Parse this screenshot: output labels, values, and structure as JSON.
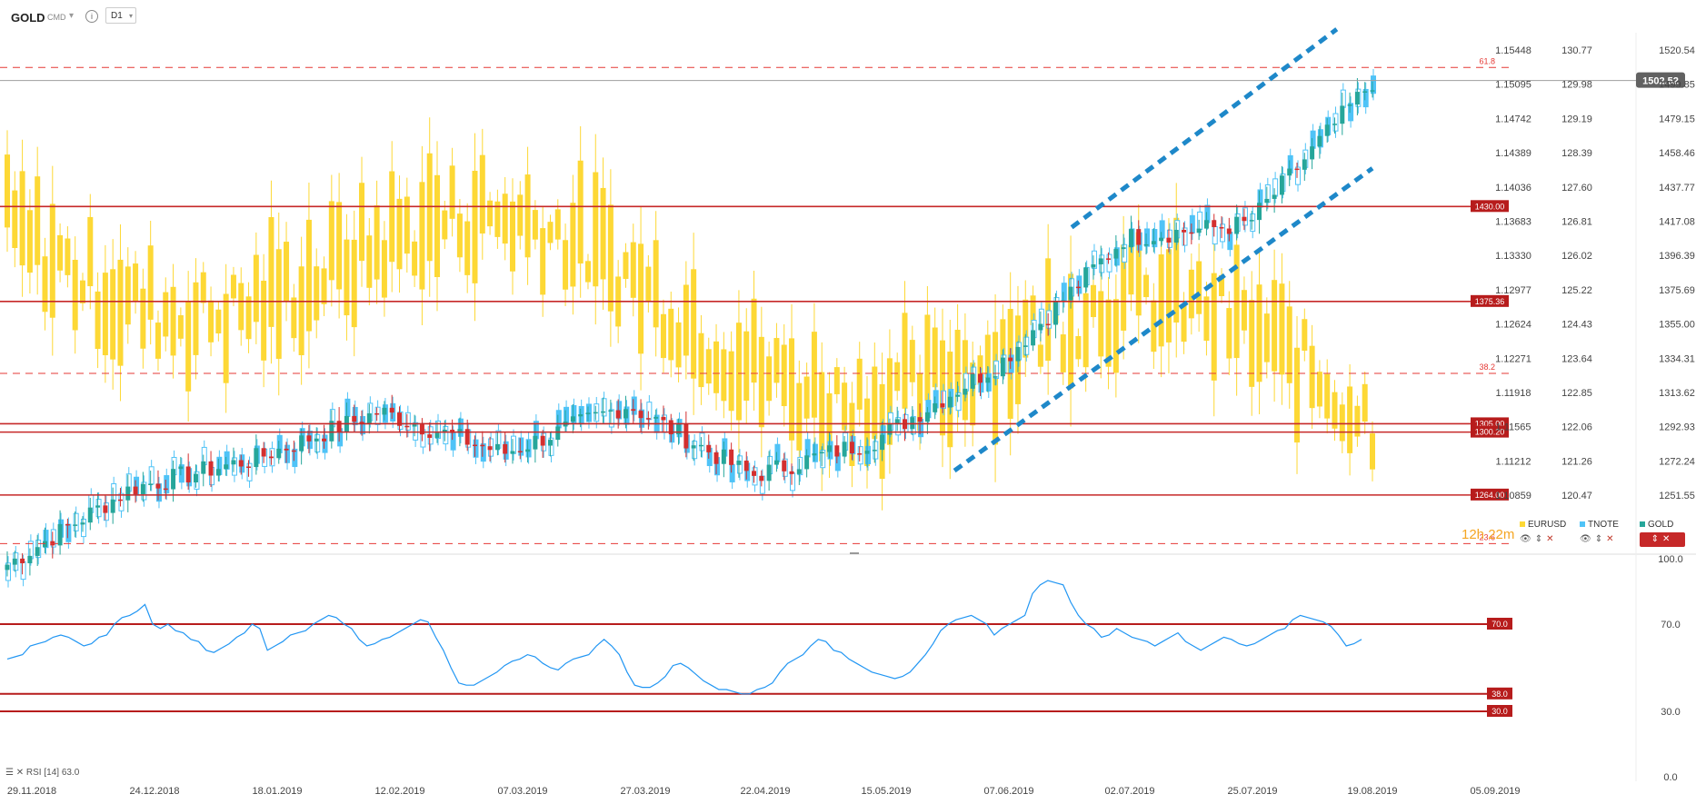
{
  "header": {
    "symbol": "GOLD",
    "instrument_type": "CMD",
    "interval": "D1",
    "info_icon": "info-icon",
    "chevron_icon": "chevron-down-icon"
  },
  "countdown": "12h 22m",
  "legend": {
    "items": [
      {
        "name": "EURUSD",
        "color": "#fdd835"
      },
      {
        "name": "TNOTE",
        "color": "#4fc3f7"
      },
      {
        "name": "GOLD",
        "color": "#26a69a"
      }
    ],
    "eye_icon": "eye-icon",
    "updown_icon": "up-down-arrows-icon",
    "close_icon": "close-icon",
    "eye_glyph": "👁",
    "updown_glyph": "⇕",
    "close_glyph": "✕"
  },
  "rsi_label": "RSI [14] 63.0",
  "chart_data": [
    {
      "type": "candlestick",
      "title": "GOLD D1",
      "overlays": [
        "EURUSD",
        "TNOTE"
      ],
      "x_tick_labels": [
        "29.11.2018",
        "24.12.2018",
        "18.01.2019",
        "12.02.2019",
        "07.03.2019",
        "27.03.2019",
        "22.04.2019",
        "15.05.2019",
        "07.06.2019",
        "02.07.2019",
        "25.07.2019",
        "19.08.2019",
        "05.09.2019"
      ],
      "ylim": [
        1231.0,
        1530.0
      ],
      "y_axis_gold": [
        "1520.54",
        "1499.85",
        "1479.15",
        "1458.46",
        "1437.77",
        "1417.08",
        "1396.39",
        "1375.69",
        "1355.00",
        "1334.31",
        "1313.62",
        "1292.93",
        "1272.24",
        "1251.55"
      ],
      "y_axis_tnote": [
        "130.77",
        "129.98",
        "129.19",
        "128.39",
        "127.60",
        "126.81",
        "126.02",
        "125.22",
        "124.43",
        "123.64",
        "122.85",
        "122.06",
        "121.26",
        "120.47"
      ],
      "y_axis_eurusd": [
        "1.15448",
        "1.15095",
        "1.14742",
        "1.14389",
        "1.14036",
        "1.13683",
        "1.13330",
        "1.12977",
        "1.12624",
        "1.12271",
        "1.11918",
        "1.11565",
        "1.11212",
        "1.10859"
      ],
      "last_price": "1502.52",
      "support_resistance": [
        {
          "label": "1430.00",
          "value": 1430.0
        },
        {
          "label": "1375.36",
          "value": 1375.36
        },
        {
          "label": "1305.00",
          "value": 1305.0
        },
        {
          "label": "1300.20",
          "value": 1300.2
        },
        {
          "label": "1264.00",
          "value": 1264.0
        }
      ],
      "fibonacci": [
        {
          "label": "61.8",
          "value": 1510.0
        },
        {
          "label": "38.2",
          "value": 1334.0
        },
        {
          "label": "23.6",
          "value": 1236.0
        }
      ],
      "band_label": "",
      "trend_channel": {
        "upper": [
          [
            "21.06.2019",
            1418
          ],
          [
            "12.08.2019",
            1532
          ]
        ],
        "lower": [
          [
            "29.05.2019",
            1278
          ],
          [
            "19.08.2019",
            1452
          ]
        ]
      },
      "gold_ohlc_approx": [
        {
          "date": "29.11.2018",
          "close": 1224
        },
        {
          "date": "24.12.2018",
          "close": 1268
        },
        {
          "date": "18.01.2019",
          "close": 1285
        },
        {
          "date": "12.02.2019",
          "close": 1312
        },
        {
          "date": "07.03.2019",
          "close": 1288
        },
        {
          "date": "27.03.2019",
          "close": 1316
        },
        {
          "date": "22.04.2019",
          "close": 1275
        },
        {
          "date": "15.05.2019",
          "close": 1296
        },
        {
          "date": "07.06.2019",
          "close": 1340
        },
        {
          "date": "02.07.2019",
          "close": 1412
        },
        {
          "date": "25.07.2019",
          "close": 1420
        },
        {
          "date": "19.08.2019",
          "close": 1502
        }
      ],
      "legend": [
        "EURUSD",
        "TNOTE",
        "GOLD"
      ]
    },
    {
      "type": "line",
      "title": "RSI [14]",
      "ylim": [
        0,
        100
      ],
      "y_tick_labels": [
        "100.0",
        "70.0",
        "30.0",
        "0.0"
      ],
      "levels": [
        {
          "label": "70.0",
          "value": 70
        },
        {
          "label": "38.0",
          "value": 38
        },
        {
          "label": "30.0",
          "value": 30
        }
      ],
      "last_value": 63.0,
      "series": [
        {
          "values": [
            54,
            55,
            56,
            60,
            61,
            62,
            64,
            65,
            64,
            62,
            60,
            61,
            64,
            65,
            70,
            73,
            74,
            76,
            79,
            70,
            68,
            70,
            67,
            66,
            63,
            62,
            58,
            57,
            59,
            61,
            64,
            66,
            70,
            68,
            58,
            60,
            62,
            65,
            66,
            67,
            70,
            72,
            74,
            73,
            70,
            68,
            63,
            60,
            61,
            63,
            64,
            66,
            68,
            70,
            72,
            71,
            64,
            58,
            50,
            43,
            42,
            42,
            44,
            46,
            48,
            51,
            53,
            54,
            56,
            55,
            52,
            50,
            49,
            52,
            54,
            55,
            56,
            60,
            63,
            60,
            56,
            48,
            42,
            41,
            41,
            43,
            46,
            51,
            52,
            50,
            47,
            44,
            42,
            40,
            40,
            39,
            38,
            38,
            40,
            41,
            43,
            48,
            52,
            54,
            56,
            60,
            63,
            62,
            58,
            57,
            54,
            52,
            50,
            48,
            47,
            46,
            45,
            46,
            48,
            52,
            56,
            61,
            67,
            70,
            72,
            73,
            74,
            72,
            70,
            65,
            68,
            70,
            72,
            74,
            84,
            88,
            90,
            89,
            88,
            80,
            74,
            70,
            68,
            64,
            65,
            68,
            66,
            64,
            63,
            62,
            60,
            62,
            64,
            66,
            62,
            60,
            58,
            60,
            62,
            64,
            63,
            61,
            60,
            61,
            63,
            65,
            67,
            68,
            72,
            74,
            73,
            72,
            71,
            69,
            65,
            60,
            61,
            63
          ]
        }
      ]
    }
  ]
}
